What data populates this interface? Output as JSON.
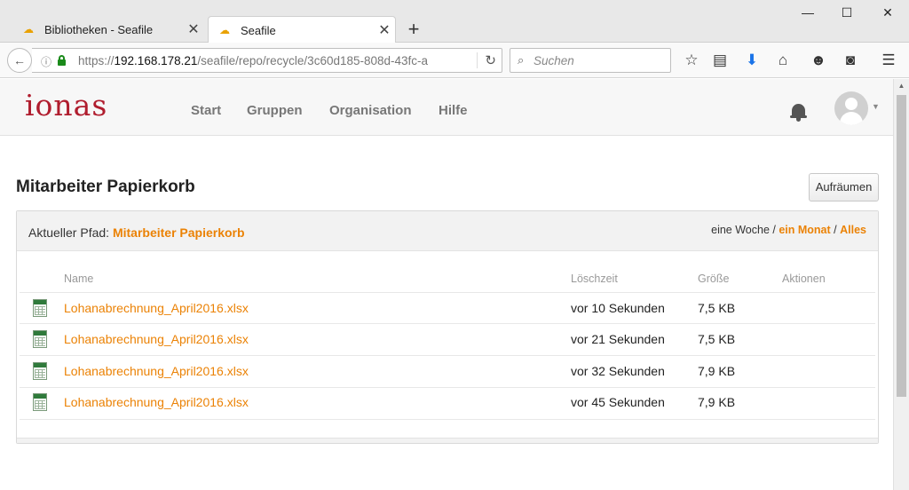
{
  "browser": {
    "tabs": [
      {
        "title": "Bibliotheken - Seafile",
        "active": false
      },
      {
        "title": "Seafile",
        "active": true
      }
    ],
    "url": {
      "prefix": "https://",
      "host": "192.168.178.21",
      "path": "/seafile/repo/recycle/3c60d185-808d-43fc-a"
    },
    "search_placeholder": "Suchen",
    "toolbar_icons": [
      "star-icon",
      "reading-list-icon",
      "download-icon",
      "home-icon",
      "smiley-icon",
      "pocket-icon",
      "menu-icon"
    ],
    "window_controls": [
      "minimize",
      "maximize",
      "close"
    ]
  },
  "app": {
    "logo": "ionas",
    "nav": [
      "Start",
      "Gruppen",
      "Organisation",
      "Hilfe"
    ],
    "brand_color": "#b01d2e",
    "accent_color": "#eb8205"
  },
  "page": {
    "title": "Mitarbeiter Papierkorb",
    "clean_button": "Aufräumen",
    "path_label": "Aktueller Pfad:",
    "path_value": "Mitarbeiter Papierkorb",
    "range": {
      "week": "eine Woche",
      "sep1": " / ",
      "month": "ein Monat",
      "sep2": " / ",
      "all": "Alles"
    },
    "columns": {
      "name": "Name",
      "deleted": "Löschzeit",
      "size": "Größe",
      "actions": "Aktionen"
    },
    "rows": [
      {
        "name": "Lohanabrechnung_April2016.xlsx",
        "deleted": "vor 10 Sekunden",
        "size": "7,5 KB"
      },
      {
        "name": "Lohanabrechnung_April2016.xlsx",
        "deleted": "vor 21 Sekunden",
        "size": "7,5 KB"
      },
      {
        "name": "Lohanabrechnung_April2016.xlsx",
        "deleted": "vor 32 Sekunden",
        "size": "7,9 KB"
      },
      {
        "name": "Lohanabrechnung_April2016.xlsx",
        "deleted": "vor 45 Sekunden",
        "size": "7,9 KB"
      }
    ]
  }
}
